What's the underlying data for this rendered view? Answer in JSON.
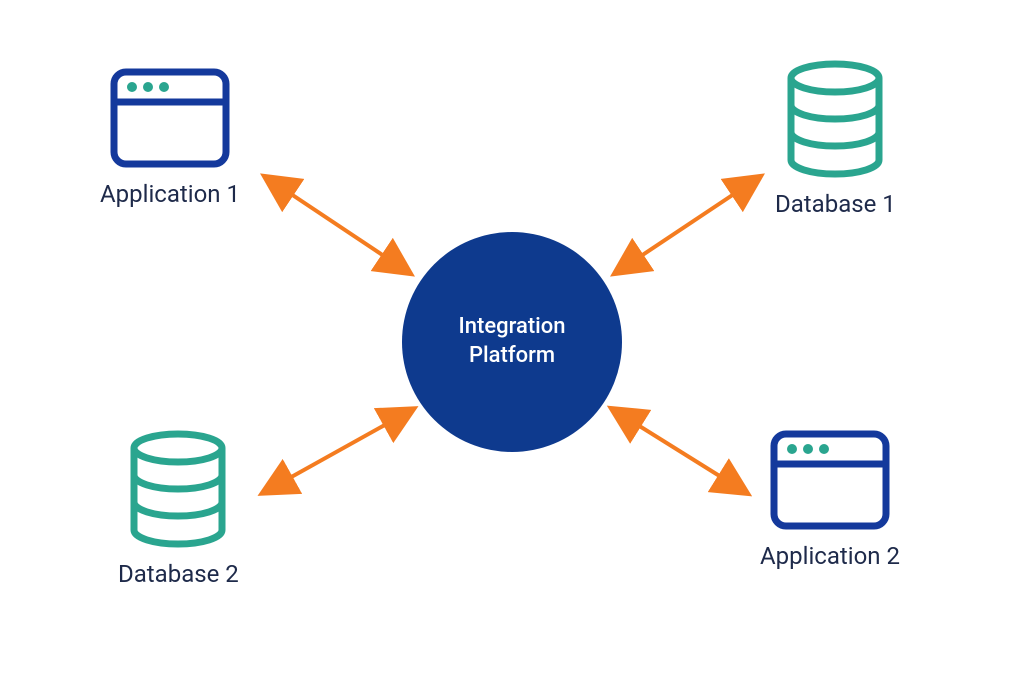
{
  "hub": {
    "line1": "Integration",
    "line2": "Platform"
  },
  "nodes": {
    "top_left": {
      "label": "Application 1",
      "type": "application"
    },
    "top_right": {
      "label": "Database 1",
      "type": "database"
    },
    "bottom_left": {
      "label": "Database 2",
      "type": "database"
    },
    "bottom_right": {
      "label": "Application 2",
      "type": "application"
    }
  },
  "colors": {
    "app_outline": "#14399c",
    "app_dots": "#2aa58f",
    "db_outline": "#2aa58f",
    "hub_bg": "#0e3a8e",
    "arrow": "#f47c20",
    "label_text": "#1e2a4a"
  }
}
